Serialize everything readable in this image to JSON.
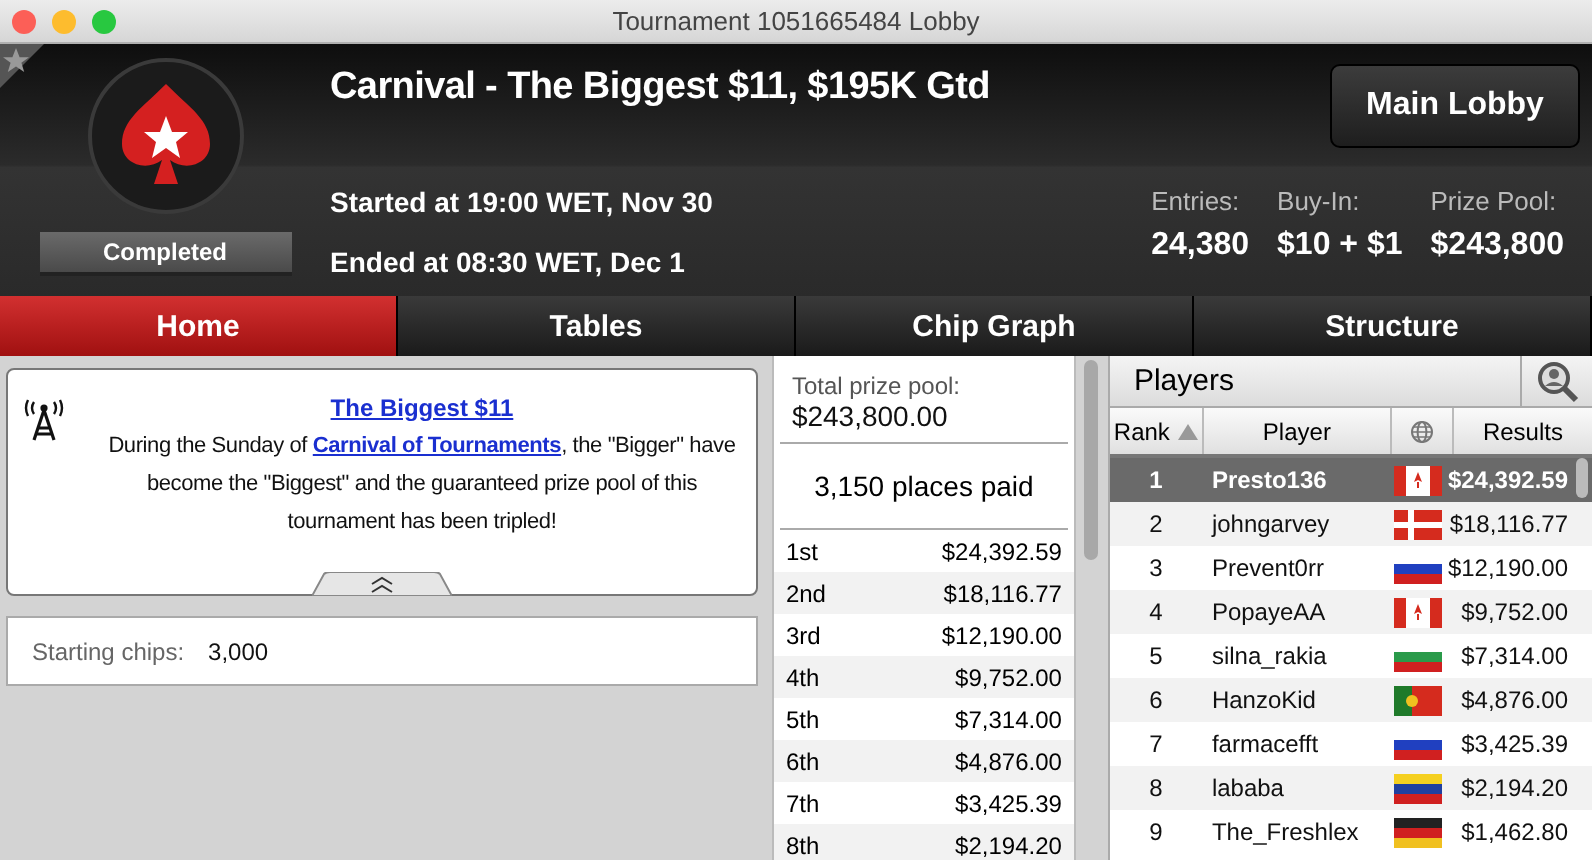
{
  "window": {
    "title": "Tournament 1051665484 Lobby"
  },
  "header": {
    "title": "Carnival - The Biggest $11, $195K Gtd",
    "status": "Completed",
    "started": "Started at 19:00 WET, Nov 30",
    "ended": "Ended at 08:30 WET, Dec 1",
    "main_lobby_button": "Main Lobby",
    "stats": [
      {
        "label": "Entries:",
        "value": "24,380"
      },
      {
        "label": "Buy-In:",
        "value": "$10 + $1"
      },
      {
        "label": "Prize Pool:",
        "value": "$243,800"
      }
    ]
  },
  "tabs": [
    {
      "label": "Home",
      "selected": true
    },
    {
      "label": "Tables",
      "selected": false
    },
    {
      "label": "Chip Graph",
      "selected": false
    },
    {
      "label": "Structure",
      "selected": false
    }
  ],
  "news": {
    "title": "The Biggest $11",
    "before": "During the Sunday of ",
    "link": "Carnival of Tournaments",
    "after": ", the \"Bigger\" have become the \"Biggest\" and the guaranteed prize pool of this tournament has been tripled!"
  },
  "starting_chips": {
    "label": "Starting chips:",
    "value": "3,000"
  },
  "prizes": {
    "total_label": "Total prize pool:",
    "total": "$243,800.00",
    "places_paid": "3,150 places paid",
    "rows": [
      {
        "place": "1st",
        "amount": "$24,392.59"
      },
      {
        "place": "2nd",
        "amount": "$18,116.77"
      },
      {
        "place": "3rd",
        "amount": "$12,190.00"
      },
      {
        "place": "4th",
        "amount": "$9,752.00"
      },
      {
        "place": "5th",
        "amount": "$7,314.00"
      },
      {
        "place": "6th",
        "amount": "$4,876.00"
      },
      {
        "place": "7th",
        "amount": "$3,425.39"
      },
      {
        "place": "8th",
        "amount": "$2,194.20"
      }
    ]
  },
  "players": {
    "title": "Players",
    "columns": [
      "Rank",
      "Player",
      "Results"
    ],
    "rows": [
      {
        "rank": "1",
        "name": "Presto136",
        "kind": "canada",
        "result": "$24,392.59",
        "selected": true
      },
      {
        "rank": "2",
        "name": "johngarvey",
        "kind": "denmark",
        "result": "$18,116.77",
        "selected": false
      },
      {
        "rank": "3",
        "name": "Prevent0rr",
        "kind": "russia",
        "result": "$12,190.00",
        "selected": false
      },
      {
        "rank": "4",
        "name": "PopayeAA",
        "kind": "canada",
        "result": "$9,752.00",
        "selected": false
      },
      {
        "rank": "5",
        "name": "silna_rakia",
        "kind": "bulgaria",
        "result": "$7,314.00",
        "selected": false
      },
      {
        "rank": "6",
        "name": "HanzoKid",
        "kind": "portugal",
        "result": "$4,876.00",
        "selected": false
      },
      {
        "rank": "7",
        "name": "farmacefft",
        "kind": "russia",
        "result": "$3,425.39",
        "selected": false
      },
      {
        "rank": "8",
        "name": "lababa",
        "kind": "colombia",
        "result": "$2,194.20",
        "selected": false
      },
      {
        "rank": "9",
        "name": "The_Freshlex",
        "kind": "germany",
        "result": "$1,462.80",
        "selected": false
      }
    ]
  }
}
